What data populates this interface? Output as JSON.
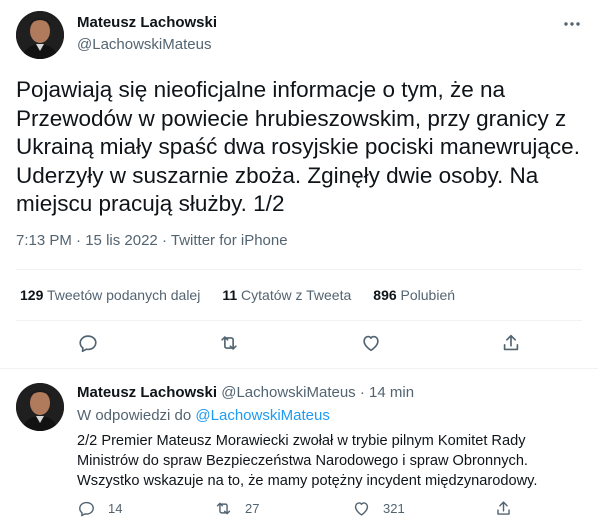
{
  "tweet": {
    "author_name": "Mateusz Lachowski",
    "author_handle": "@LachowskiMateus",
    "text": "Pojawiają się nieoficjalne informacje o tym, że na Przewodów w powiecie hrubieszowskim, przy granicy z Ukrainą miały spaść dwa rosyjskie pociski manewrujące. Uderzyły w suszarnie zboża. Zginęły dwie osoby. Na miejscu pracują służby. 1/2",
    "time": "7:13 PM",
    "date": "15 lis 2022",
    "separator": "·",
    "source": "Twitter for iPhone",
    "stats": {
      "retweets_count": "129",
      "retweets_label": "Tweetów podanych dalej",
      "quotes_count": "11",
      "quotes_label": "Cytatów z Tweeta",
      "likes_count": "896",
      "likes_label": "Polubień"
    }
  },
  "reply": {
    "author_name": "Mateusz Lachowski",
    "author_handle": "@LachowskiMateus",
    "separator": "·",
    "time_ago": "14 min",
    "replying_prefix": "W odpowiedzi do",
    "replying_to": "@LachowskiMateus",
    "text": "2/2 Premier Mateusz Morawiecki zwołał w trybie pilnym Komitet Rady Ministrów do spraw Bezpieczeństwa Narodowego i spraw Obronnych. Wszystko wskazuje na to, że mamy potężny incydent międzynarodowy.",
    "replies_count": "14",
    "retweets_count": "27",
    "likes_count": "321"
  },
  "colors": {
    "text_primary": "#0f1419",
    "text_secondary": "#536471",
    "link": "#1d9bf0",
    "divider": "#eff3f4"
  },
  "icons": [
    "more-icon",
    "reply-icon",
    "retweet-icon",
    "like-icon",
    "share-icon"
  ]
}
